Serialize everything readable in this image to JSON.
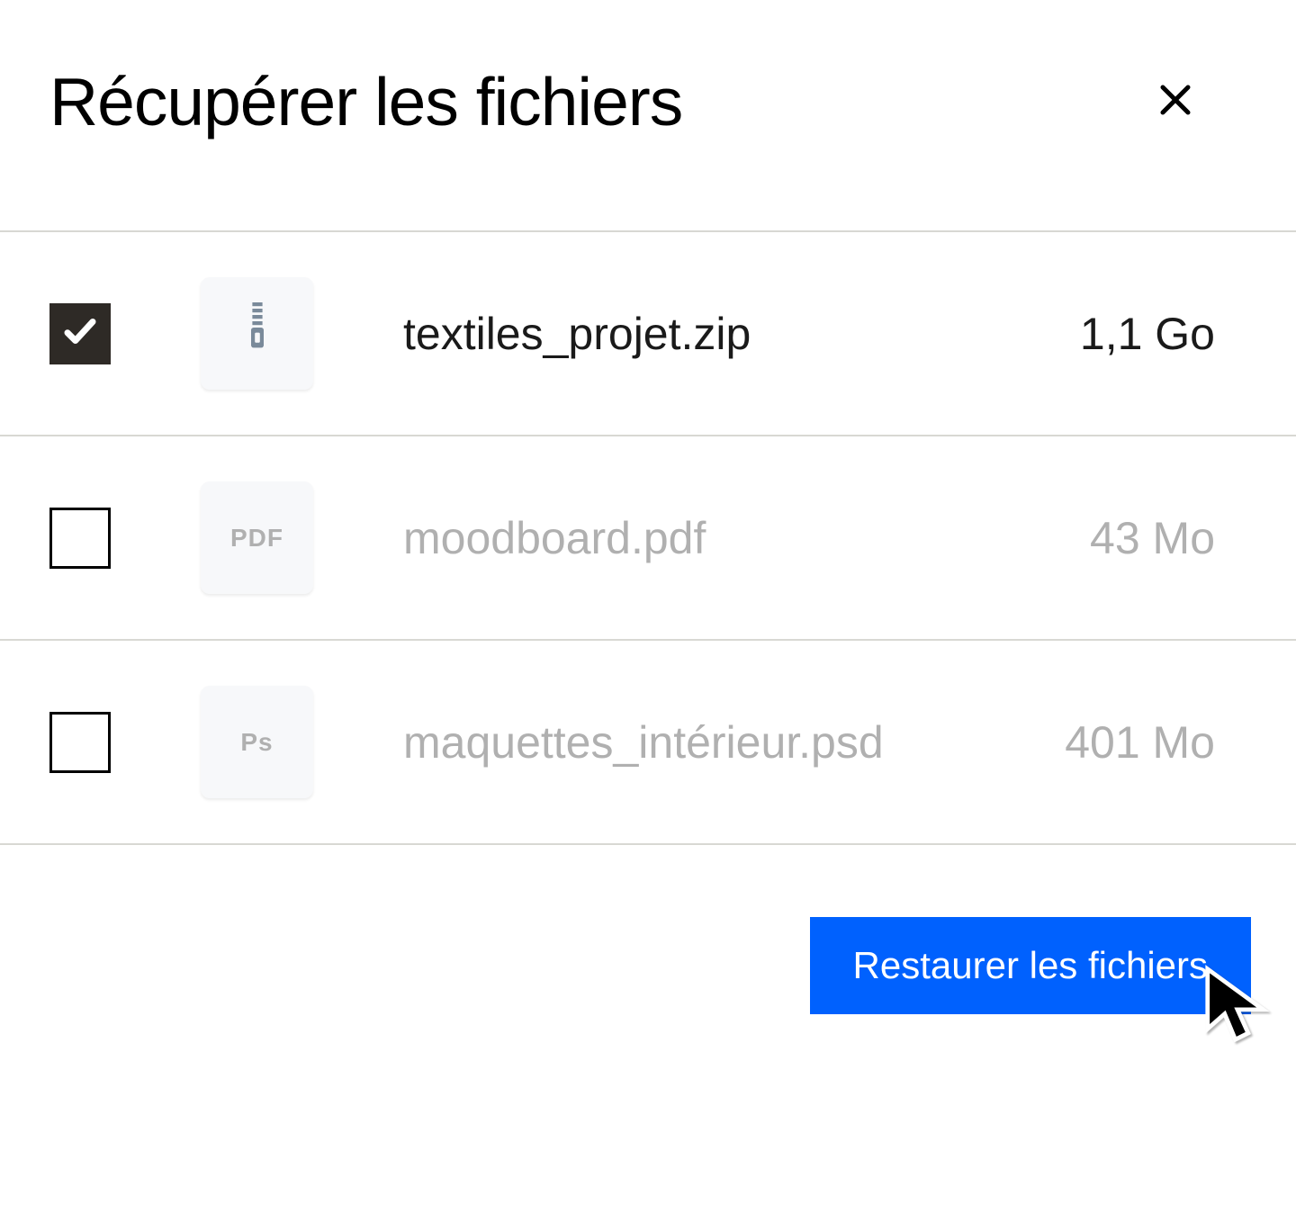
{
  "dialog": {
    "title": "Récupérer les fichiers",
    "restore_button": "Restaurer les fichiers"
  },
  "files": [
    {
      "name": "textiles_projet.zip",
      "size": "1,1 Go",
      "icon_type": "zip",
      "icon_label": "",
      "selected": true
    },
    {
      "name": "moodboard.pdf",
      "size": "43 Mo",
      "icon_type": "pdf",
      "icon_label": "PDF",
      "selected": false
    },
    {
      "name": "maquettes_intérieur.psd",
      "size": "401 Mo",
      "icon_type": "psd",
      "icon_label": "Ps",
      "selected": false
    }
  ]
}
